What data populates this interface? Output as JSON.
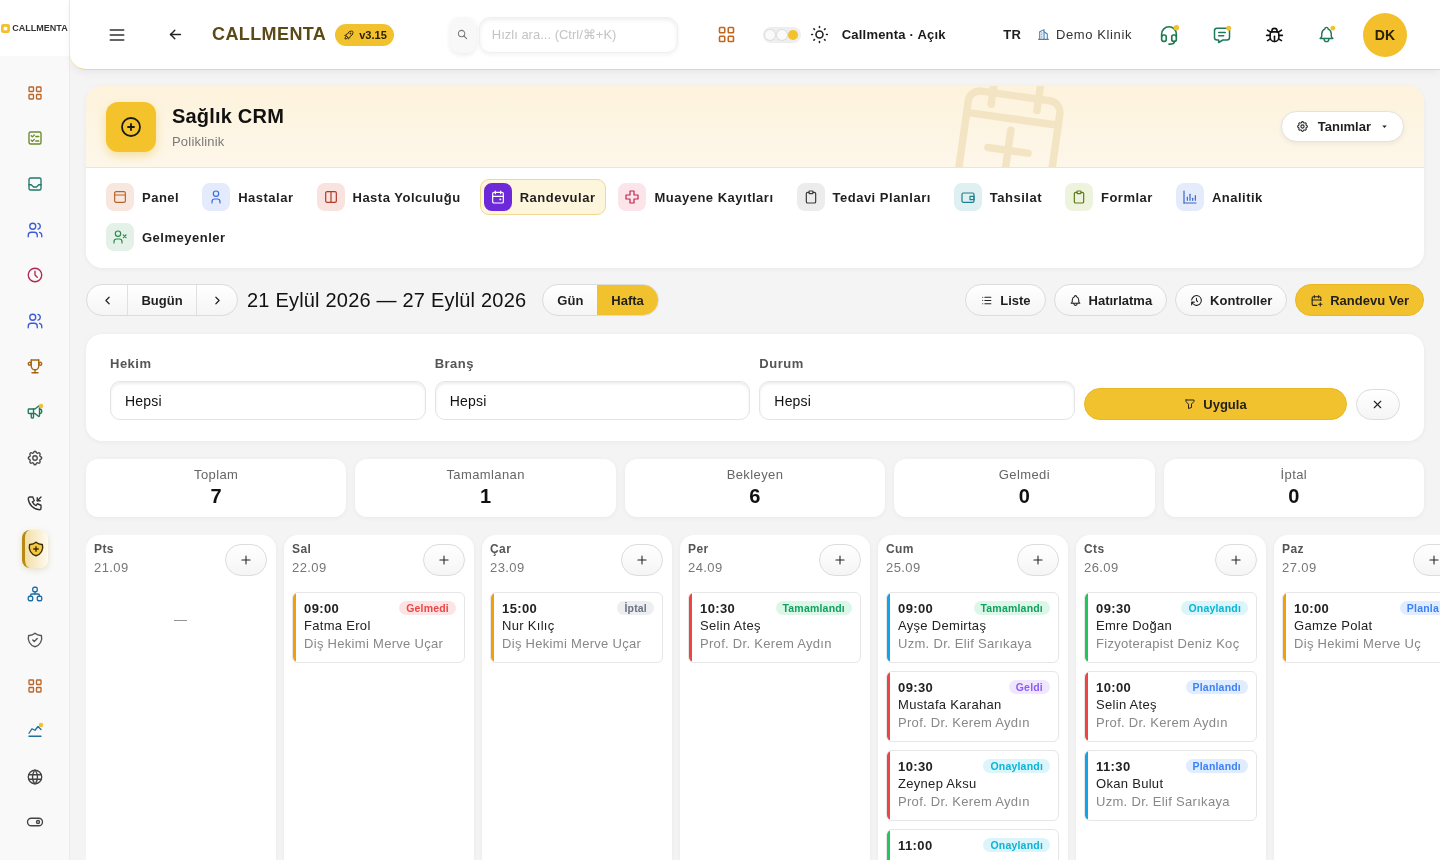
{
  "sidebar": {
    "logo": "CALLMENTA",
    "items": [
      {
        "selected": false
      },
      {
        "selected": false
      },
      {
        "selected": false
      },
      {
        "selected": false
      },
      {
        "selected": false
      },
      {
        "selected": false
      },
      {
        "selected": false
      },
      {
        "selected": false
      },
      {
        "selected": false
      },
      {
        "selected": false
      },
      {
        "selected": true
      },
      {
        "selected": false
      },
      {
        "selected": false
      },
      {
        "selected": false
      },
      {
        "selected": false
      },
      {
        "selected": false
      },
      {
        "selected": false
      }
    ]
  },
  "topbar": {
    "brand": "CALLMENTA",
    "version": "v3.15",
    "search": {
      "placeholder": "Hızlı ara... (Ctrl/⌘+K)"
    },
    "theme_options": [
      {
        "selected": false
      },
      {
        "selected": false
      },
      {
        "selected": true
      }
    ],
    "theme": "Callmenta · Açık",
    "language": "TR",
    "clinic": "Demo Klinik",
    "avatar": "DK"
  },
  "header": {
    "title": "Sağlık CRM",
    "subtitle": "Poliklinik",
    "menu_button": "Tanımlar"
  },
  "tabs": [
    {
      "label": "Panel",
      "selected": false
    },
    {
      "label": "Hastalar",
      "selected": false
    },
    {
      "label": "Hasta Yolculuğu",
      "selected": false
    },
    {
      "label": "Randevular",
      "selected": true
    },
    {
      "label": "Muayene Kayıtları",
      "selected": false
    },
    {
      "label": "Tedavi Planları",
      "selected": false
    },
    {
      "label": "Tahsilat",
      "selected": false
    },
    {
      "label": "Formlar",
      "selected": false
    },
    {
      "label": "Analitik",
      "selected": false
    },
    {
      "label": "Gelmeyenler",
      "selected": false
    }
  ],
  "toolbar": {
    "today": "Bugün",
    "range": "21 Eylül 2026 — 27 Eylül 2026",
    "views": [
      {
        "label": "Gün",
        "selected": false
      },
      {
        "label": "Hafta",
        "selected": true
      }
    ],
    "actions": [
      {
        "label": "Liste",
        "kind": "plain"
      },
      {
        "label": "Hatırlatma",
        "kind": "plain"
      },
      {
        "label": "Kontroller",
        "kind": "plain"
      },
      {
        "label": "Randevu Ver",
        "kind": "primary"
      }
    ]
  },
  "filters": {
    "fields": [
      {
        "label": "Hekim",
        "value": "Hepsi"
      },
      {
        "label": "Branş",
        "value": "Hepsi"
      },
      {
        "label": "Durum",
        "value": "Hepsi"
      }
    ],
    "apply": "Uygula"
  },
  "stats": [
    {
      "label": "Toplam",
      "value": "7"
    },
    {
      "label": "Tamamlanan",
      "value": "1"
    },
    {
      "label": "Bekleyen",
      "value": "6"
    },
    {
      "label": "Gelmedi",
      "value": "0"
    },
    {
      "label": "İptal",
      "value": "0"
    }
  ],
  "week": [
    {
      "day": "Pts",
      "date": "21.09",
      "empty_text": "—"
    },
    {
      "day": "Sal",
      "date": "22.09",
      "appointments": [
        {
          "time": "09:00",
          "status": {
            "label": "Gelmedi",
            "kind": "no_show"
          },
          "patient": "Fatma Erol",
          "doctor": "Diş Hekimi Merve Uçar",
          "color": "#f59e0b"
        }
      ]
    },
    {
      "day": "Çar",
      "date": "23.09",
      "appointments": [
        {
          "time": "15:00",
          "status": {
            "label": "İptal",
            "kind": "cancelled"
          },
          "patient": "Nur Kılıç",
          "doctor": "Diş Hekimi Merve Uçar",
          "color": "#f59e0b"
        }
      ]
    },
    {
      "day": "Per",
      "date": "24.09",
      "appointments": [
        {
          "time": "10:30",
          "status": {
            "label": "Tamamlandı",
            "kind": "completed"
          },
          "patient": "Selin Ateş",
          "doctor": "Prof. Dr. Kerem Aydın",
          "color": "#ef4444"
        }
      ]
    },
    {
      "day": "Cum",
      "date": "25.09",
      "appointments": [
        {
          "time": "09:00",
          "status": {
            "label": "Tamamlandı",
            "kind": "completed"
          },
          "patient": "Ayşe Demirtaş",
          "doctor": "Uzm. Dr. Elif Sarıkaya",
          "color": "#0ea5e9"
        },
        {
          "time": "09:30",
          "status": {
            "label": "Geldi",
            "kind": "arrived"
          },
          "patient": "Mustafa Karahan",
          "doctor": "Prof. Dr. Kerem Aydın",
          "color": "#ef4444"
        },
        {
          "time": "10:30",
          "status": {
            "label": "Onaylandı",
            "kind": "confirmed"
          },
          "patient": "Zeynep Aksu",
          "doctor": "Prof. Dr. Kerem Aydın",
          "color": "#ef4444"
        },
        {
          "time": "11:00",
          "status": {
            "label": "Onaylandı",
            "kind": "confirmed"
          },
          "color": "#22c55e"
        }
      ]
    },
    {
      "day": "Cts",
      "date": "26.09",
      "appointments": [
        {
          "time": "09:30",
          "status": {
            "label": "Onaylandı",
            "kind": "confirmed"
          },
          "patient": "Emre Doğan",
          "doctor": "Fizyoterapist Deniz Koç",
          "color": "#22c55e"
        },
        {
          "time": "10:00",
          "status": {
            "label": "Planlandı",
            "kind": "planned"
          },
          "patient": "Selin Ateş",
          "doctor": "Prof. Dr. Kerem Aydın",
          "color": "#ef4444"
        },
        {
          "time": "11:30",
          "status": {
            "label": "Planlandı",
            "kind": "planned"
          },
          "patient": "Okan Bulut",
          "doctor": "Uzm. Dr. Elif Sarıkaya",
          "color": "#0ea5e9"
        }
      ]
    },
    {
      "day": "Paz",
      "date": "27.09",
      "appointments": [
        {
          "time": "10:00",
          "status": {
            "label": "Planla",
            "kind": "planned"
          },
          "patient": "Gamze Polat",
          "doctor": "Diş Hekimi Merve Uç",
          "color": "#f59e0b"
        }
      ]
    }
  ]
}
